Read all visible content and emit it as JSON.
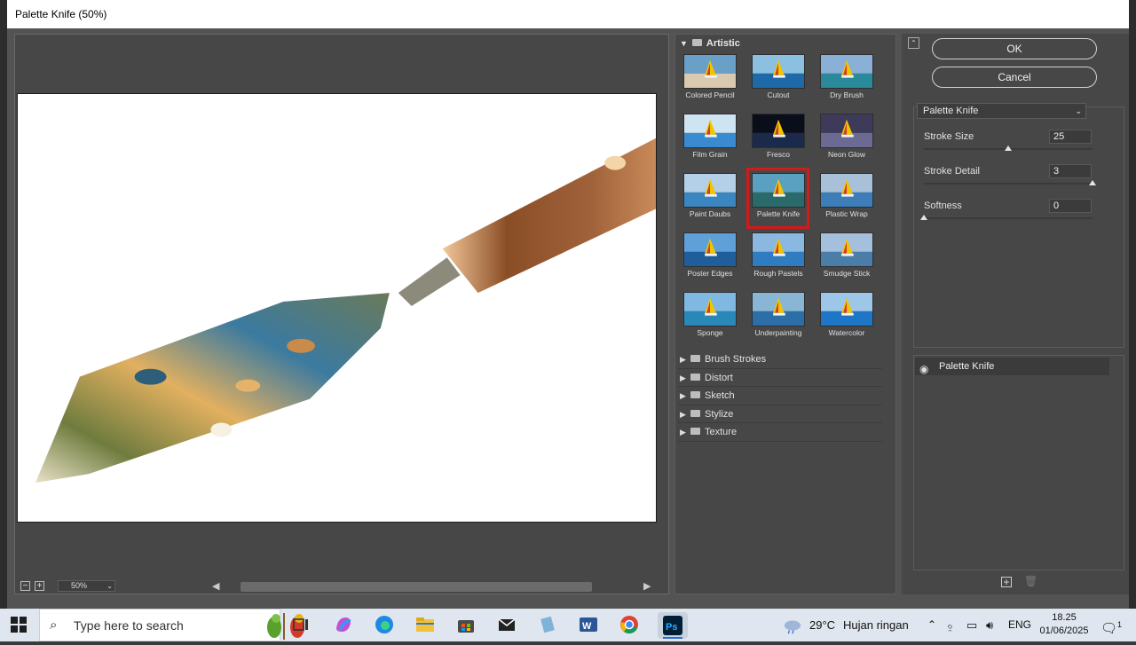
{
  "window": {
    "title": "Palette Knife (50%)"
  },
  "preview": {
    "zoom": "50%",
    "minus": "−",
    "plus": "+",
    "scroll_left": "◀",
    "scroll_right": "▶"
  },
  "gallery": {
    "open_category": "Artistic",
    "filters": [
      {
        "label": "Colored Pencil",
        "icon": "colored-pencil-thumbnail"
      },
      {
        "label": "Cutout",
        "icon": "cutout-thumbnail"
      },
      {
        "label": "Dry Brush",
        "icon": "dry-brush-thumbnail"
      },
      {
        "label": "Film Grain",
        "icon": "film-grain-thumbnail"
      },
      {
        "label": "Fresco",
        "icon": "fresco-thumbnail"
      },
      {
        "label": "Neon Glow",
        "icon": "neon-glow-thumbnail"
      },
      {
        "label": "Paint Daubs",
        "icon": "paint-daubs-thumbnail"
      },
      {
        "label": "Palette Knife",
        "icon": "palette-knife-thumbnail",
        "selected": true
      },
      {
        "label": "Plastic Wrap",
        "icon": "plastic-wrap-thumbnail"
      },
      {
        "label": "Poster Edges",
        "icon": "poster-edges-thumbnail"
      },
      {
        "label": "Rough Pastels",
        "icon": "rough-pastels-thumbnail"
      },
      {
        "label": "Smudge Stick",
        "icon": "smudge-stick-thumbnail"
      },
      {
        "label": "Sponge",
        "icon": "sponge-thumbnail"
      },
      {
        "label": "Underpainting",
        "icon": "underpainting-thumbnail"
      },
      {
        "label": "Watercolor",
        "icon": "watercolor-thumbnail"
      }
    ],
    "categories": [
      "Brush Strokes",
      "Distort",
      "Sketch",
      "Stylize",
      "Texture"
    ],
    "selection_color": "#d11b1b"
  },
  "panel": {
    "ok_label": "OK",
    "cancel_label": "Cancel",
    "filter_select": "Palette Knife",
    "params": [
      {
        "label": "Stroke Size",
        "value": "25",
        "level_fraction": 0.5
      },
      {
        "label": "Stroke Detail",
        "value": "3",
        "level_fraction": 1.0
      },
      {
        "label": "Softness",
        "value": "0",
        "level_fraction": 0.0
      }
    ],
    "layer_name": "Palette Knife",
    "new_layer_icon": "new-effect-layer-icon",
    "delete_layer_icon": "delete-effect-layer-icon"
  },
  "taskbar": {
    "search_placeholder": "Type here to search",
    "weather_temp": "29°C",
    "weather_desc": "Hujan ringan",
    "lang": "ENG",
    "time": "18.25",
    "date": "01/06/2025",
    "notif_count": "1"
  }
}
